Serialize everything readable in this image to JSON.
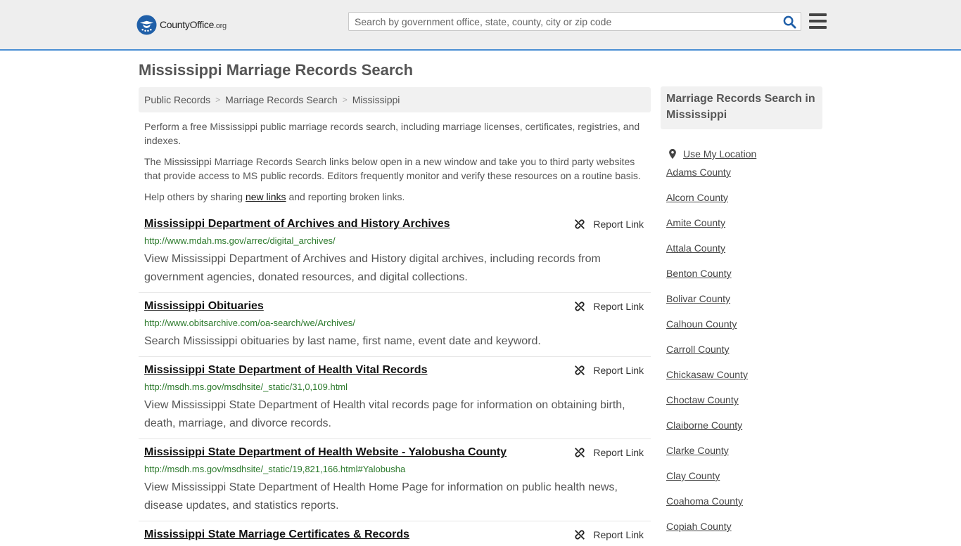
{
  "header": {
    "logo": {
      "name": "County",
      "name_bold": "Office",
      "tld": ".org"
    },
    "search": {
      "placeholder": "Search by government office, state, county, city or zip code"
    }
  },
  "page": {
    "title": "Mississippi Marriage Records Search",
    "breadcrumb": [
      "Public Records",
      "Marriage Records Search",
      "Mississippi"
    ],
    "intro": {
      "p1": "Perform a free Mississippi public marriage records search, including marriage licenses, certificates, registries, and indexes.",
      "p2": "The Mississippi Marriage Records Search links below open in a new window and take you to third party websites that provide access to MS public records. Editors frequently monitor and verify these resources on a routine basis.",
      "p3_before": "Help others by sharing ",
      "p3_link": "new links",
      "p3_after": " and reporting broken links."
    },
    "report_label": "Report Link",
    "results": [
      {
        "title": "Mississippi Department of Archives and History Archives",
        "url": "http://www.mdah.ms.gov/arrec/digital_archives/",
        "description": "View Mississippi Department of Archives and History digital archives, including records from government agencies, donated resources, and digital collections."
      },
      {
        "title": "Mississippi Obituaries",
        "url": "http://www.obitsarchive.com/oa-search/we/Archives/",
        "description": "Search Mississippi obituaries by last name, first name, event date and keyword."
      },
      {
        "title": "Mississippi State Department of Health Vital Records",
        "url": "http://msdh.ms.gov/msdhsite/_static/31,0,109.html",
        "description": "View Mississippi State Department of Health vital records page for information on obtaining birth, death, marriage, and divorce records."
      },
      {
        "title": "Mississippi State Department of Health Website - Yalobusha County",
        "url": "http://msdh.ms.gov/msdhsite/_static/19,821,166.html#Yalobusha",
        "description": "View Mississippi State Department of Health Home Page for information on public health news, disease updates, and statistics reports."
      },
      {
        "title": "Mississippi State Marriage Certificates & Records",
        "url": "",
        "description": ""
      }
    ]
  },
  "sidebar": {
    "title": "Marriage Records Search in Mississippi",
    "location_label": "Use My Location",
    "counties": [
      "Adams County",
      "Alcorn County",
      "Amite County",
      "Attala County",
      "Benton County",
      "Bolivar County",
      "Calhoun County",
      "Carroll County",
      "Chickasaw County",
      "Choctaw County",
      "Claiborne County",
      "Clarke County",
      "Clay County",
      "Coahoma County",
      "Copiah County"
    ]
  },
  "colors": {
    "accent": "#4a8fd3",
    "logo_blue": "#1f5fa8",
    "url_green": "#2c7a2c"
  }
}
